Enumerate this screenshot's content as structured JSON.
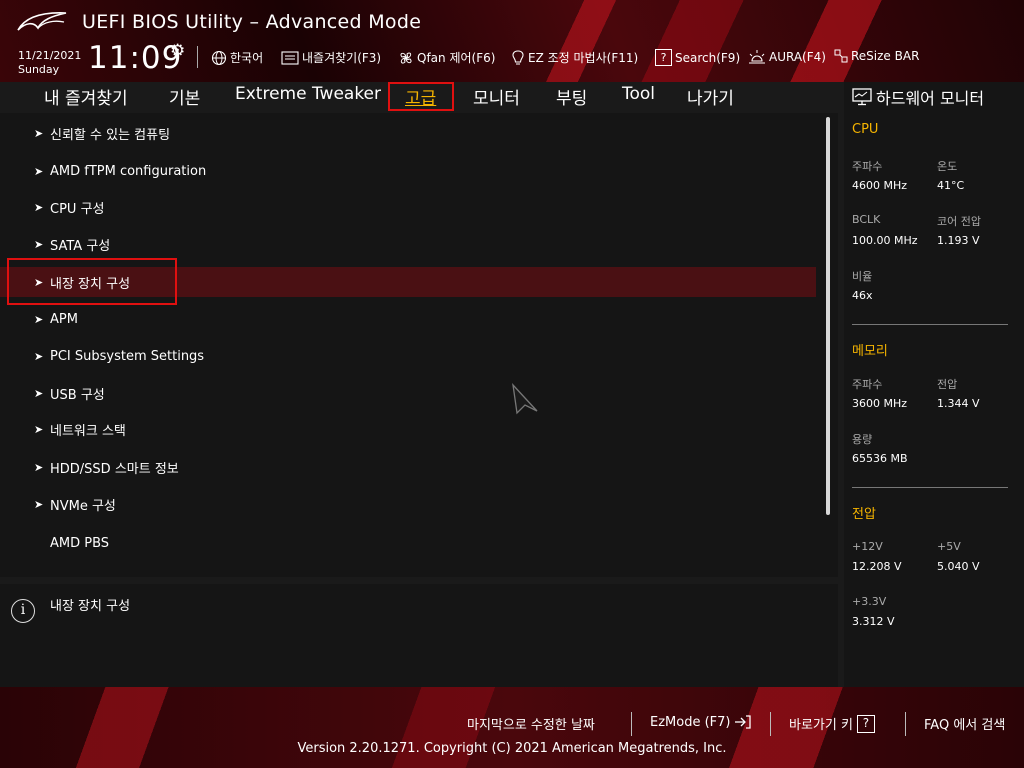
{
  "header": {
    "title": "UEFI BIOS Utility – Advanced Mode",
    "date": "11/21/2021",
    "day": "Sunday",
    "time": "11:09",
    "items": [
      {
        "label": "한국어",
        "icon": "globe-icon"
      },
      {
        "label": "내즐겨찾기(F3)",
        "icon": "favorites-icon"
      },
      {
        "label": "Qfan 제어(F6)",
        "icon": "fan-icon"
      },
      {
        "label": "EZ 조정 마법사(F11)",
        "icon": "bulb-icon"
      },
      {
        "label": "Search(F9)",
        "icon": "help-icon"
      },
      {
        "label": "AURA(F4)",
        "icon": "aura-icon"
      },
      {
        "label": "ReSize BAR",
        "icon": "resize-bar-icon"
      }
    ]
  },
  "tabs": [
    "내 즐겨찾기",
    "기본",
    "Extreme Tweaker",
    "고급",
    "모니터",
    "부팅",
    "Tool",
    "나가기"
  ],
  "active_tab": "고급",
  "menu_items": [
    "신뢰할 수 있는 컴퓨팅",
    "AMD fTPM configuration",
    "CPU 구성",
    "SATA 구성",
    "내장 장치 구성",
    "APM",
    "PCI Subsystem Settings",
    "USB 구성",
    "네트워크 스택",
    "HDD/SSD 스마트 정보",
    "NVMe 구성",
    "AMD PBS"
  ],
  "selected_item": "내장 장치 구성",
  "help_text": "내장 장치 구성",
  "hardware_monitor": {
    "title": "하드웨어 모니터",
    "cpu": {
      "label": "CPU",
      "freq_label": "주파수",
      "freq": "4600 MHz",
      "temp_label": "온도",
      "temp": "41°C",
      "bclk_label": "BCLK",
      "bclk": "100.00 MHz",
      "vcore_label": "코어 전압",
      "vcore": "1.193 V",
      "ratio_label": "비율",
      "ratio": "46x"
    },
    "memory": {
      "label": "메모리",
      "freq_label": "주파수",
      "freq": "3600 MHz",
      "volt_label": "전압",
      "volt": "1.344 V",
      "cap_label": "용량",
      "cap": "65536 MB"
    },
    "voltage": {
      "label": "전압",
      "v12_label": "+12V",
      "v12": "12.208 V",
      "v5_label": "+5V",
      "v5": "5.040 V",
      "v33_label": "+3.3V",
      "v33": "3.312 V"
    }
  },
  "footer": {
    "last_modified": "마지막으로 수정한 날짜",
    "ezmode": "EzMode (F7)",
    "hotkeys": "바로가기 키",
    "faq": "FAQ 에서 검색",
    "version": "Version 2.20.1271. Copyright (C) 2021 American Megatrends, Inc."
  }
}
